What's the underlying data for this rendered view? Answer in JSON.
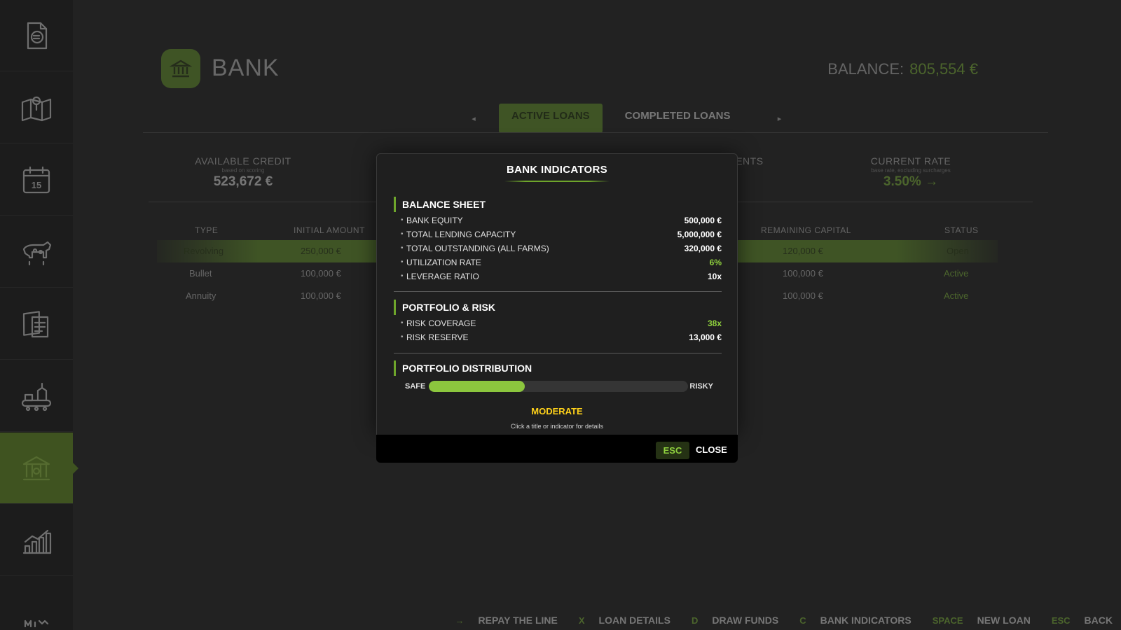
{
  "sidebar": {
    "items": [
      {
        "icon": "finance-document-icon"
      },
      {
        "icon": "map-pin-icon"
      },
      {
        "icon": "calendar-icon",
        "day": "15"
      },
      {
        "icon": "cow-icon"
      },
      {
        "icon": "contracts-icon"
      },
      {
        "icon": "production-icon"
      },
      {
        "icon": "bank-icon",
        "active": true
      },
      {
        "icon": "statistics-icon"
      },
      {
        "icon": "more-icon"
      }
    ]
  },
  "header": {
    "title": "BANK",
    "balance_label": "BALANCE:",
    "balance_value": "805,554 €"
  },
  "tabs": {
    "items": [
      "ACTIVE LOANS",
      "COMPLETED LOANS"
    ],
    "prev": "◂",
    "next": "▸"
  },
  "stats": {
    "available_credit": {
      "label": "AVAILABLE CREDIT",
      "sub": "based on scoring",
      "value": "523,672 €"
    },
    "payments": {
      "label": "TMENTS"
    },
    "current_rate": {
      "label": "CURRENT RATE",
      "sub": "base rate, excluding surcharges",
      "value": "3.50% →"
    }
  },
  "table": {
    "headers": {
      "type": "TYPE",
      "initial": "INITIAL AMOUNT",
      "remaining": "REMAINING CAPITAL",
      "status": "STATUS"
    },
    "rows": [
      {
        "type": "Revolving",
        "initial": "250,000 €",
        "remaining": "120,000 €",
        "status": "Open"
      },
      {
        "type": "Bullet",
        "initial": "100,000 €",
        "remaining": "100,000 €",
        "status": "Active"
      },
      {
        "type": "Annuity",
        "initial": "100,000 €",
        "remaining": "100,000 €",
        "status": "Active"
      }
    ]
  },
  "footer": {
    "hints": [
      {
        "key": "→",
        "label": "REPAY THE LINE"
      },
      {
        "key": "X",
        "label": "LOAN DETAILS"
      },
      {
        "key": "D",
        "label": "DRAW FUNDS"
      },
      {
        "key": "C",
        "label": "BANK INDICATORS"
      },
      {
        "key": "SPACE",
        "label": "NEW LOAN"
      },
      {
        "key": "ESC",
        "label": "BACK"
      }
    ]
  },
  "modal": {
    "title": "BANK INDICATORS",
    "balance_sheet": {
      "title": "BALANCE SHEET",
      "items": [
        {
          "name": "BANK EQUITY",
          "value": "500,000 €"
        },
        {
          "name": "TOTAL LENDING CAPACITY",
          "value": "5,000,000 €"
        },
        {
          "name": "TOTAL OUTSTANDING (ALL FARMS)",
          "value": "320,000 €"
        },
        {
          "name": "UTILIZATION RATE",
          "value": "6%"
        },
        {
          "name": "LEVERAGE RATIO",
          "value": "10x"
        }
      ]
    },
    "portfolio_risk": {
      "title": "PORTFOLIO & RISK",
      "items": [
        {
          "name": "RISK COVERAGE",
          "value": "38x"
        },
        {
          "name": "RISK RESERVE",
          "value": "13,000 €"
        }
      ]
    },
    "distribution": {
      "title": "PORTFOLIO DISTRIBUTION",
      "safe_label": "SAFE",
      "risky_label": "RISKY",
      "level": 0.37,
      "rating": "MODERATE",
      "hint": "Click a title or indicator for details"
    },
    "footer": {
      "key": "ESC",
      "close_label": "CLOSE"
    }
  },
  "colors": {
    "accent": "#6ea52b",
    "positive": "#8fd13e",
    "warning": "#ffd21a",
    "background": "#222222"
  }
}
